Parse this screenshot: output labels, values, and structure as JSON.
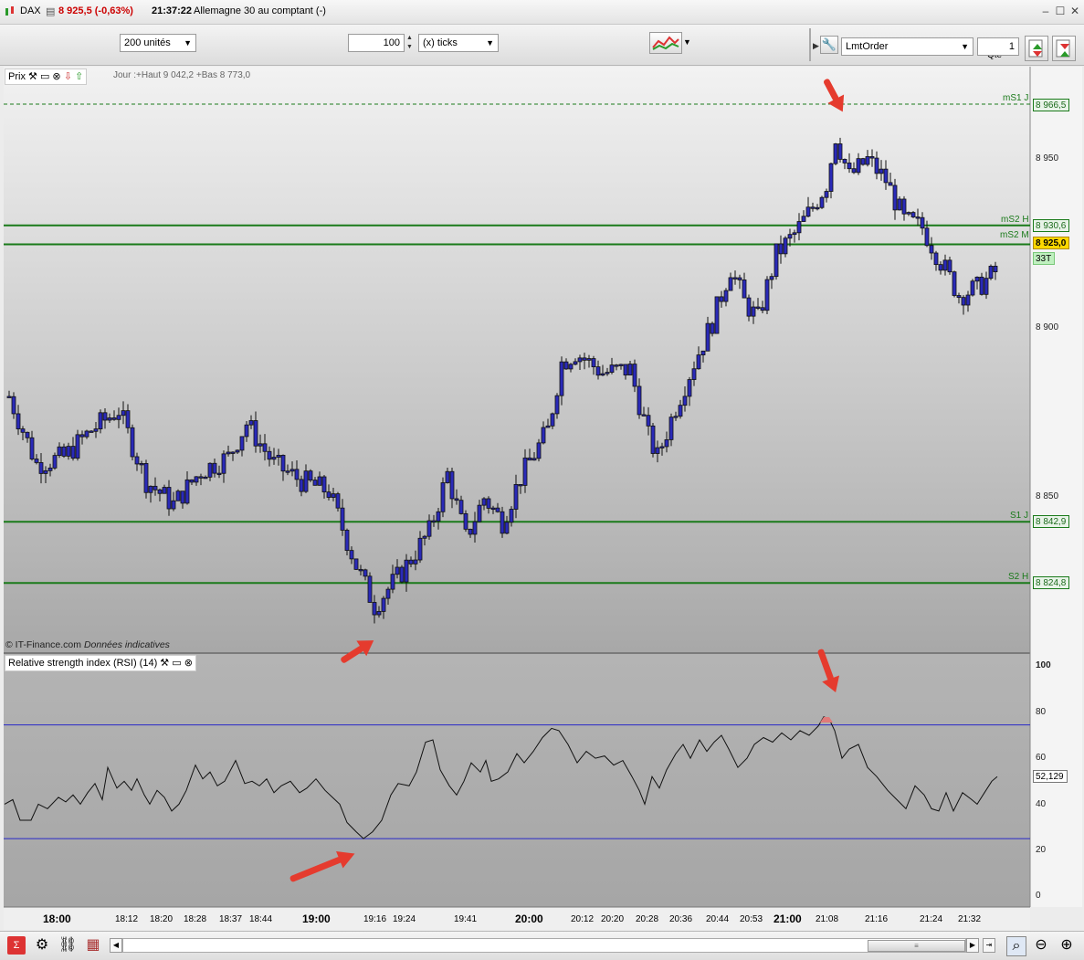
{
  "titlebar": {
    "symbol": "DAX",
    "price": "8 925,5 (-0,63%)",
    "time": "21:37:22",
    "instrument": "Allemagne 30 au comptant (-)"
  },
  "toolbar": {
    "units": "200 unités",
    "ticks_value": "100",
    "ticks_unit": "(x) ticks",
    "order_type": "LmtOrder",
    "qty_label": "Qté",
    "qty_value": "1"
  },
  "price_panel": {
    "title": "Prix",
    "info": "Jour :+Haut 9 042,2 +Bas 8 773,0",
    "copyright": "© IT-Finance.com",
    "disclaimer": "Données indicatives",
    "grid_labels": [
      "8 950",
      "8 900",
      "8 850"
    ],
    "levels": [
      {
        "name": "mS1 J",
        "value": "8 966,5"
      },
      {
        "name": "mS2 H",
        "value": "8 930,6"
      },
      {
        "name": "mS2 M",
        "value": "8 925,0"
      },
      {
        "name": "S1 J",
        "value": "8 842,9"
      },
      {
        "name": "S2 H",
        "value": "8 824,8"
      }
    ],
    "ticks_badge": "33T"
  },
  "rsi_panel": {
    "title": "Relative strength index (RSI) (14)",
    "value": "52,129",
    "axis_labels": [
      "100",
      "80",
      "60",
      "40",
      "20",
      "0"
    ]
  },
  "time_axis": [
    "18:00",
    "18:12",
    "18:20",
    "18:28",
    "18:37",
    "18:44",
    "19:00",
    "19:16",
    "19:24",
    "19:41",
    "20:00",
    "20:12",
    "20:20",
    "20:28",
    "20:36",
    "20:44",
    "20:53",
    "21:00",
    "21:08",
    "21:16",
    "21:24",
    "21:32"
  ],
  "colors": {
    "candle": "#2a2ab8",
    "level": "#1a7a1a",
    "rsi_band": "#2828c8",
    "arrow": "#e53b2e"
  }
}
